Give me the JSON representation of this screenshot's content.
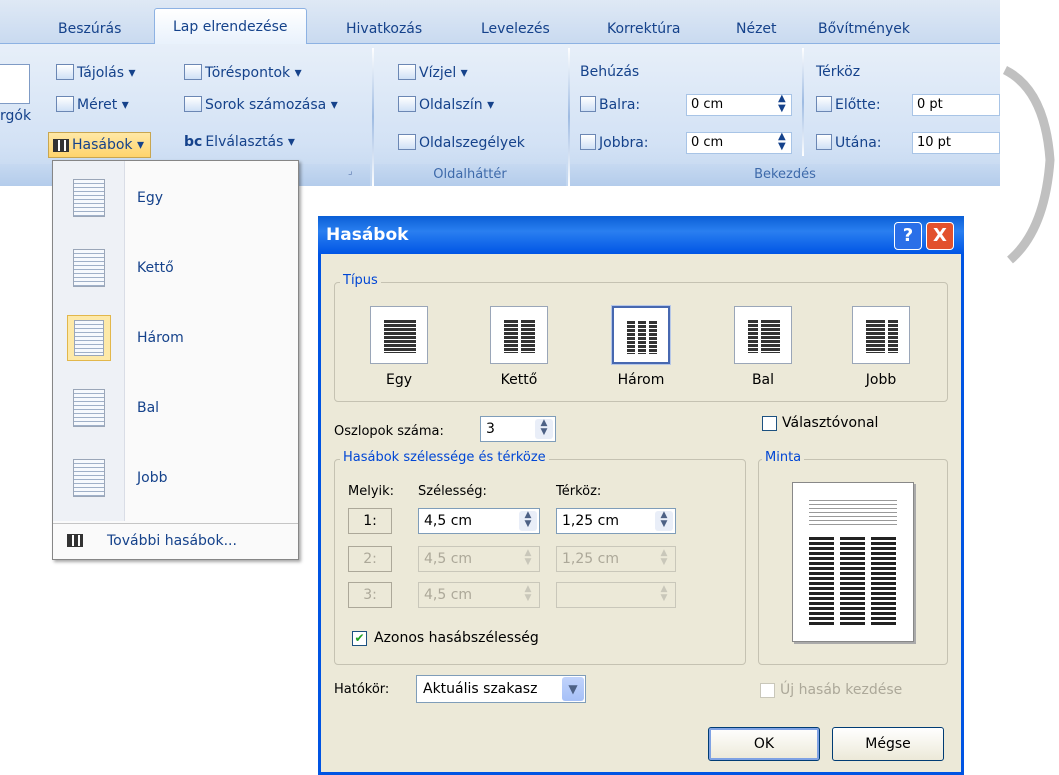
{
  "ribbon": {
    "tabs": [
      "Beszúrás",
      "Lap elrendezése",
      "Hivatkozás",
      "Levelezés",
      "Korrektúra",
      "Nézet",
      "Bővítmények"
    ],
    "active_tab": "Lap elrendezése",
    "page_setup": {
      "margins_partial": "rgók",
      "orientation": "Tájolás",
      "size": "Méret",
      "columns": "Hasábok",
      "breaks": "Töréspontok",
      "line_numbers": "Sorok számozása",
      "hyphenation": "Elválasztás"
    },
    "page_background": {
      "watermark": "Vízjel",
      "page_color": "Oldalszín",
      "page_borders": "Oldalszegélyek",
      "caption": "Oldalháttér"
    },
    "paragraph": {
      "indent_title": "Behúzás",
      "left_label": "Balra:",
      "left_value": "0 cm",
      "right_label": "Jobbra:",
      "right_value": "0 cm",
      "spacing_title": "Térköz",
      "before_label": "Előtte:",
      "before_value": "0 pt",
      "after_label": "Utána:",
      "after_value": "10 pt",
      "caption": "Bekezdés"
    }
  },
  "menu": {
    "items": [
      "Egy",
      "Kettő",
      "Három",
      "Bal",
      "Jobb"
    ],
    "highlighted": "Három",
    "more": "További hasábok..."
  },
  "dialog": {
    "title": "Hasábok",
    "help": "?",
    "close": "X",
    "type_legend": "Típus",
    "presets": [
      "Egy",
      "Kettő",
      "Három",
      "Bal",
      "Jobb"
    ],
    "selected_preset": "Három",
    "num_columns_label": "Oszlopok száma:",
    "num_columns_value": "3",
    "line_between": "Választóvonal",
    "width_spacing_legend": "Hasábok szélessége és térköze",
    "col_header": "Melyik:",
    "width_header": "Szélesség:",
    "spacing_header": "Térköz:",
    "rows": [
      {
        "num": "1:",
        "width": "4,5 cm",
        "spacing": "1,25 cm"
      },
      {
        "num": "2:",
        "width": "4,5 cm",
        "spacing": "1,25 cm"
      },
      {
        "num": "3:",
        "width": "4,5 cm",
        "spacing": ""
      }
    ],
    "equal_width": "Azonos hasábszélesség",
    "preview_legend": "Minta",
    "apply_label": "Hatókör:",
    "apply_value": "Aktuális szakasz",
    "new_column": "Új hasáb kezdése",
    "ok": "OK",
    "cancel": "Mégse"
  }
}
